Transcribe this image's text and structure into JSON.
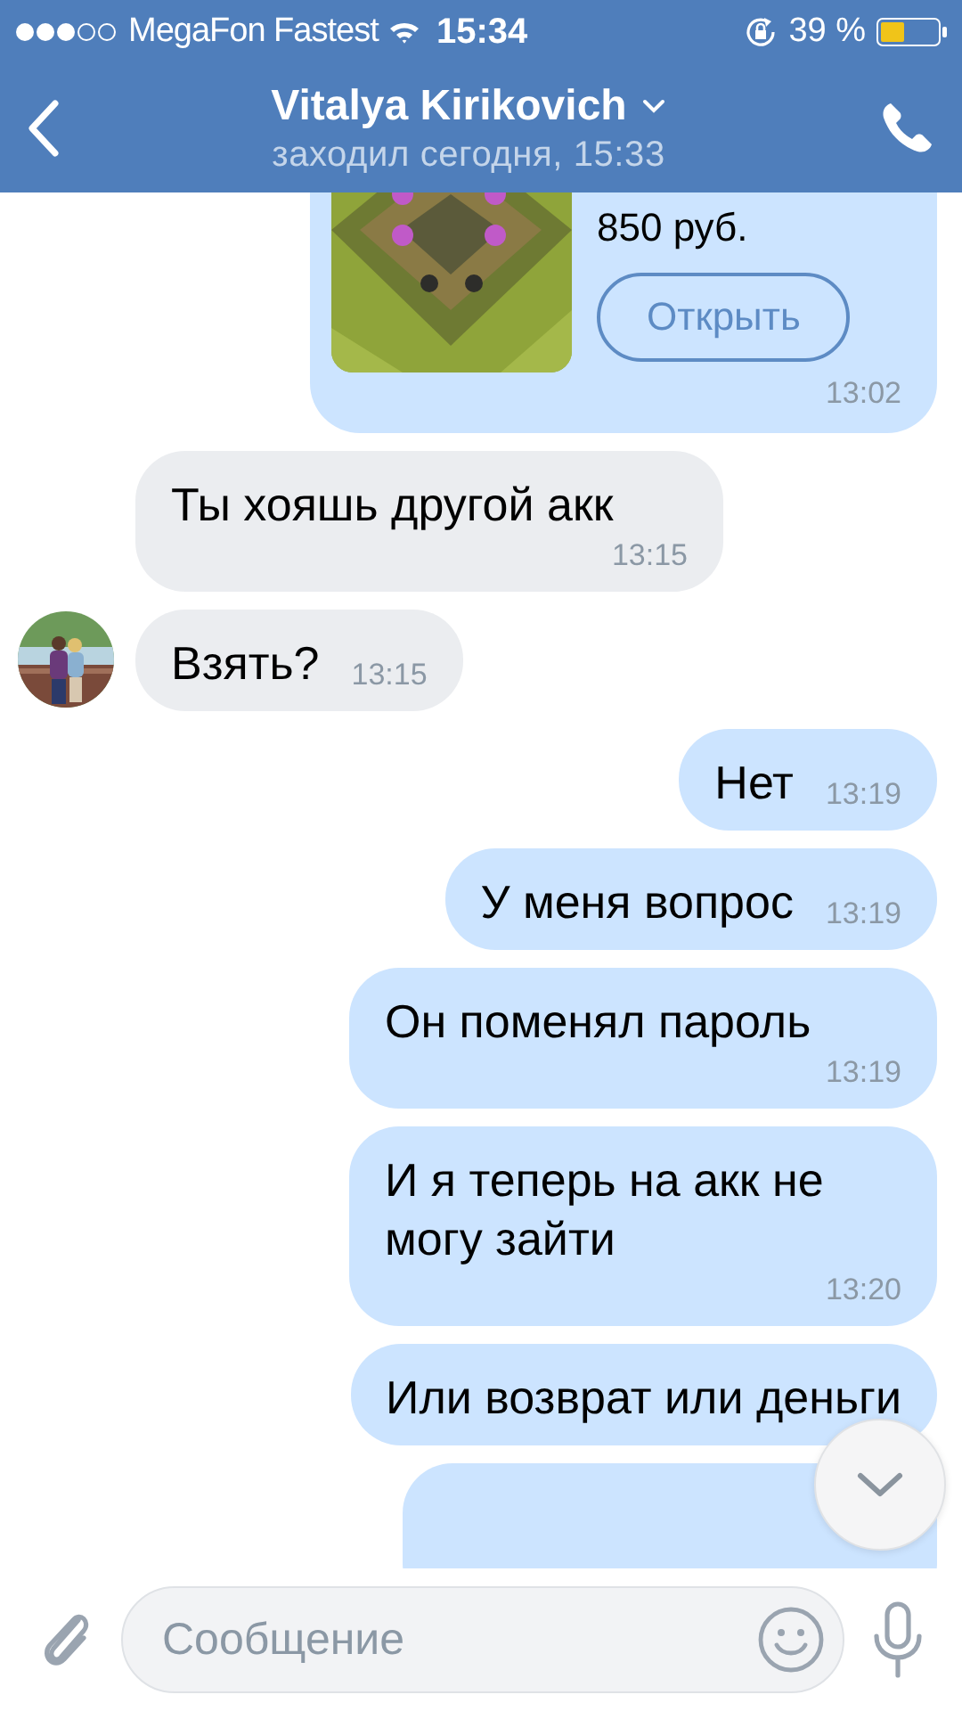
{
  "status_bar": {
    "carrier": "MegaFon Fastest",
    "time": "15:34",
    "battery": "39 %"
  },
  "header": {
    "title": "Vitalya Kirikovich",
    "subtitle": "заходил сегодня, 15:33"
  },
  "messages": [
    {
      "kind": "link_card",
      "price": "850 руб.",
      "button": "Открыть",
      "time": "13:02"
    },
    {
      "kind": "incoming",
      "avatar": false,
      "text": "Ты хояшь другой акк",
      "time": "13:15"
    },
    {
      "kind": "incoming",
      "avatar": true,
      "text": "Взять?",
      "time": "13:15"
    },
    {
      "kind": "outgoing",
      "text": "Нет",
      "time": "13:19"
    },
    {
      "kind": "outgoing",
      "text": "У меня вопрос",
      "time": "13:19"
    },
    {
      "kind": "outgoing",
      "text": "Он поменял пароль",
      "time": "13:19"
    },
    {
      "kind": "outgoing",
      "text": "И я теперь на акк не могу зайти",
      "time": "13:20"
    },
    {
      "kind": "outgoing",
      "text": "Или возврат или деньги"
    },
    {
      "kind": "outgoing"
    }
  ],
  "composer": {
    "placeholder": "Сообщение"
  }
}
